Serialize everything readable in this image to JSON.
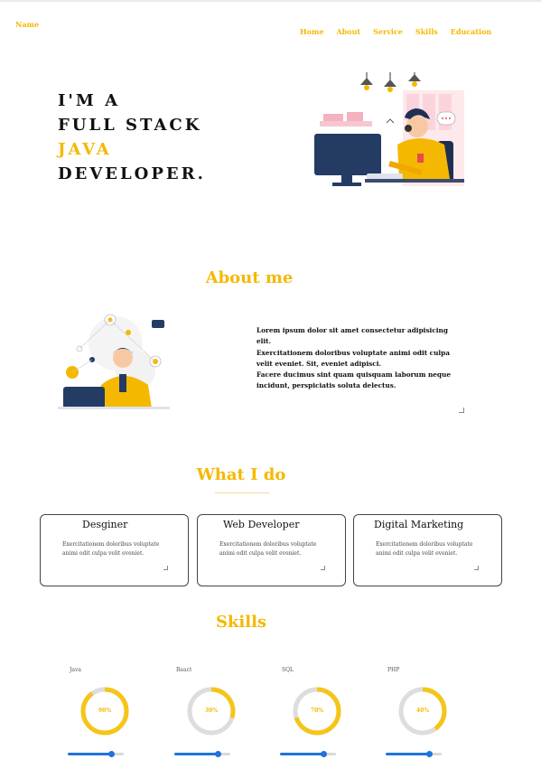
{
  "brand": "Name",
  "nav": [
    "Home",
    "About",
    "Service",
    "Skills",
    "Education"
  ],
  "hero": {
    "line1": "I'M A",
    "line2": "FULL STACK",
    "line3": "JAVA",
    "line4": "DEVELOPER."
  },
  "about": {
    "title": "About me",
    "p1": "Lorem ipsum dolor sit amet consectetur adipisicing elit.",
    "p2": " Exercitationem doloribus voluptate animi odit culpa velit eveniet. Sit, eveniet adipisci.",
    "p3": " Facere ducimus sint quam quisquam laborum neque incidunt, perspiciatis soluta delectus."
  },
  "services": {
    "title": "What I do",
    "cards": [
      {
        "title": "Desginer",
        "desc": "Exercitationem doloribus voluptate animi odit culpa velit eveniet."
      },
      {
        "title": "Web Developer",
        "desc": "Exercitationem doloribus voluptate animi odit culpa velit eveniet."
      },
      {
        "title": "Digital Marketing",
        "desc": "Exercitationem doloribus voluptate animi odit culpa velit eveniet."
      }
    ]
  },
  "skills": {
    "title": "Skills",
    "items": [
      {
        "name": "Java",
        "percent": 90,
        "label": "90%"
      },
      {
        "name": "React",
        "percent": 30,
        "label": "30%"
      },
      {
        "name": "SQL",
        "percent": 70,
        "label": "70%"
      },
      {
        "name": "PHP",
        "percent": 40,
        "label": "40%"
      }
    ],
    "slider_level": 0.78
  },
  "colors": {
    "accent": "#f5b800",
    "slider": "#1e74d8",
    "ring_track": "#dddddd"
  }
}
